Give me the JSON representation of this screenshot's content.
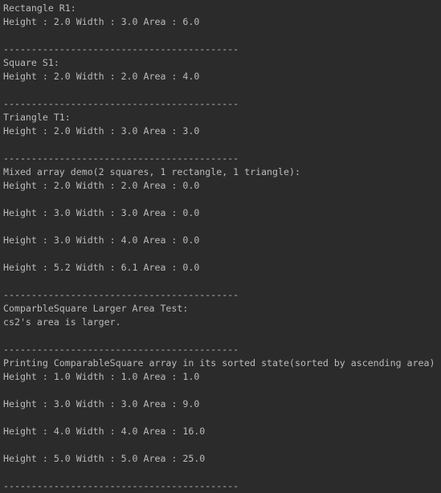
{
  "console": {
    "lines": [
      "Rectangle R1:",
      "Height : 2.0 Width : 3.0 Area : 6.0",
      "",
      "------------------------------------------",
      "Square S1:",
      "Height : 2.0 Width : 2.0 Area : 4.0",
      "",
      "------------------------------------------",
      "Triangle T1:",
      "Height : 2.0 Width : 3.0 Area : 3.0",
      "",
      "------------------------------------------",
      "Mixed array demo(2 squares, 1 rectangle, 1 triangle):",
      "Height : 2.0 Width : 2.0 Area : 0.0",
      "",
      "Height : 3.0 Width : 3.0 Area : 0.0",
      "",
      "Height : 3.0 Width : 4.0 Area : 0.0",
      "",
      "Height : 5.2 Width : 6.1 Area : 0.0",
      "",
      "------------------------------------------",
      "ComparbleSquare Larger Area Test:",
      "cs2's area is larger.",
      "",
      "------------------------------------------",
      "Printing ComparableSquare array in its sorted state(sorted by ascending area)",
      "Height : 1.0 Width : 1.0 Area : 1.0",
      "",
      "Height : 3.0 Width : 3.0 Area : 9.0",
      "",
      "Height : 4.0 Width : 4.0 Area : 16.0",
      "",
      "Height : 5.0 Width : 5.0 Area : 25.0",
      "",
      "------------------------------------------"
    ]
  }
}
